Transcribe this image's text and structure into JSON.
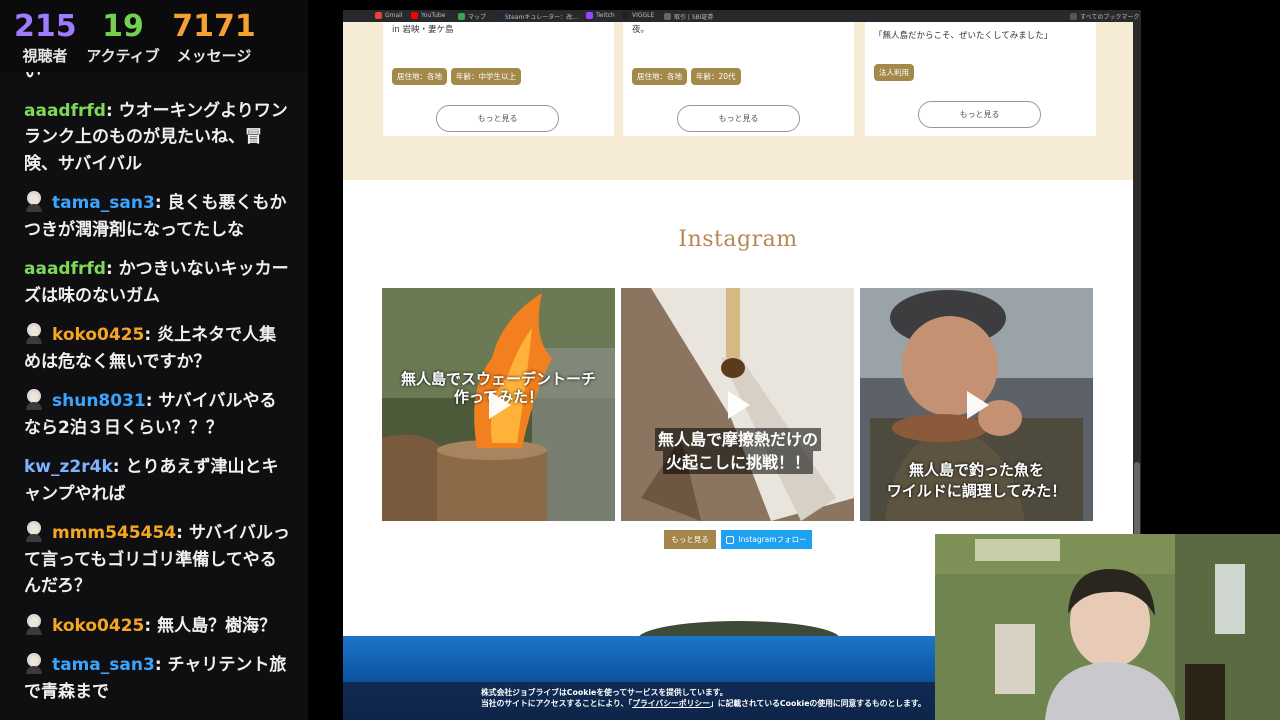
{
  "stats": {
    "viewers": {
      "value": "215",
      "label": "視聴者",
      "color": "#a07bff"
    },
    "active": {
      "value": "19",
      "label": "アクティブ",
      "color": "#74d04e"
    },
    "messages": {
      "value": "7171",
      "label": "メッセージ",
      "color": "#f3a231"
    }
  },
  "chat": {
    "partial_line": "い",
    "messages": [
      {
        "user": "aaadfrfd",
        "text": "ウオーキングよりワンランク上のものが見たいね、冒険、サバイバル",
        "color": "#7ed957",
        "avatar": false
      },
      {
        "user": "tama_san3",
        "text": "良くも悪くもかつきが潤滑剤になってたしな",
        "color": "#3aa4ff",
        "avatar": true
      },
      {
        "user": "aaadfrfd",
        "text": "かつきいないキッカーズは味のないガム",
        "color": "#7ed957",
        "avatar": false
      },
      {
        "user": "koko0425",
        "text": "炎上ネタで人集めは危なく無いですか？",
        "color": "#f5a623",
        "avatar": true
      },
      {
        "user": "shun8031",
        "text": "サバイバルやるなら2泊３日くらい？？？",
        "color": "#3aa4ff",
        "avatar": true
      },
      {
        "user": "kw_z2r4k",
        "text": "とりあえず津山とキャンプやれば",
        "color": "#7fb3ff",
        "avatar": false
      },
      {
        "user": "mmm545454",
        "text": "サバイバルって言ってもゴリゴリ準備してやるんだろ？",
        "color": "#f5a623",
        "avatar": true
      },
      {
        "user": "koko0425",
        "text": "無人島？樹海？",
        "color": "#f5a623",
        "avatar": true
      },
      {
        "user": "tama_san3",
        "text": "チャリテント旅で青森まで",
        "color": "#3aa4ff",
        "avatar": true
      }
    ]
  },
  "bookmarks": [
    "Gmail",
    "YouTube",
    "マップ",
    "Steamキュレーター：改...",
    "Twitch",
    "VIGGLE",
    "取引 | SBI証券",
    "すべてのブックマーク"
  ],
  "page": {
    "cards": [
      {
        "text": "in 岩映・妻ケ島",
        "tags": [
          "居住地：各地",
          "年齢：中学生以上"
        ],
        "more": "もっと見る"
      },
      {
        "text": "夜。",
        "tags": [
          "居住地：各地",
          "年齢：20代"
        ],
        "more": "もっと見る"
      },
      {
        "text": "「無人島だからこそ、ぜいたくしてみました」",
        "tags": [
          "法人利用"
        ],
        "more": "もっと見る"
      }
    ],
    "instagram_title": "Instagram",
    "posts": [
      {
        "caption_l1": "無人島でスウェーデントーチ",
        "caption_l2": "作ってみた！"
      },
      {
        "caption_l1": "無人島で摩擦熱だけの",
        "caption_l2": "火起こしに挑戦！！"
      },
      {
        "caption_l1": "無人島で釣った魚を",
        "caption_l2": "ワイルドに調理してみた！"
      }
    ],
    "more_button": "もっと見る",
    "follow_button": "Instagramフォロー",
    "cookie_l1": "株式会社ジョブライブはCookieを使ってサービスを提供しています。",
    "cookie_l2a": "当社のサイトにアクセスすることにより、「",
    "cookie_link": "プライバシーポリシー",
    "cookie_l2b": "」に記載されているCookieの使用に同意するものとします。"
  }
}
